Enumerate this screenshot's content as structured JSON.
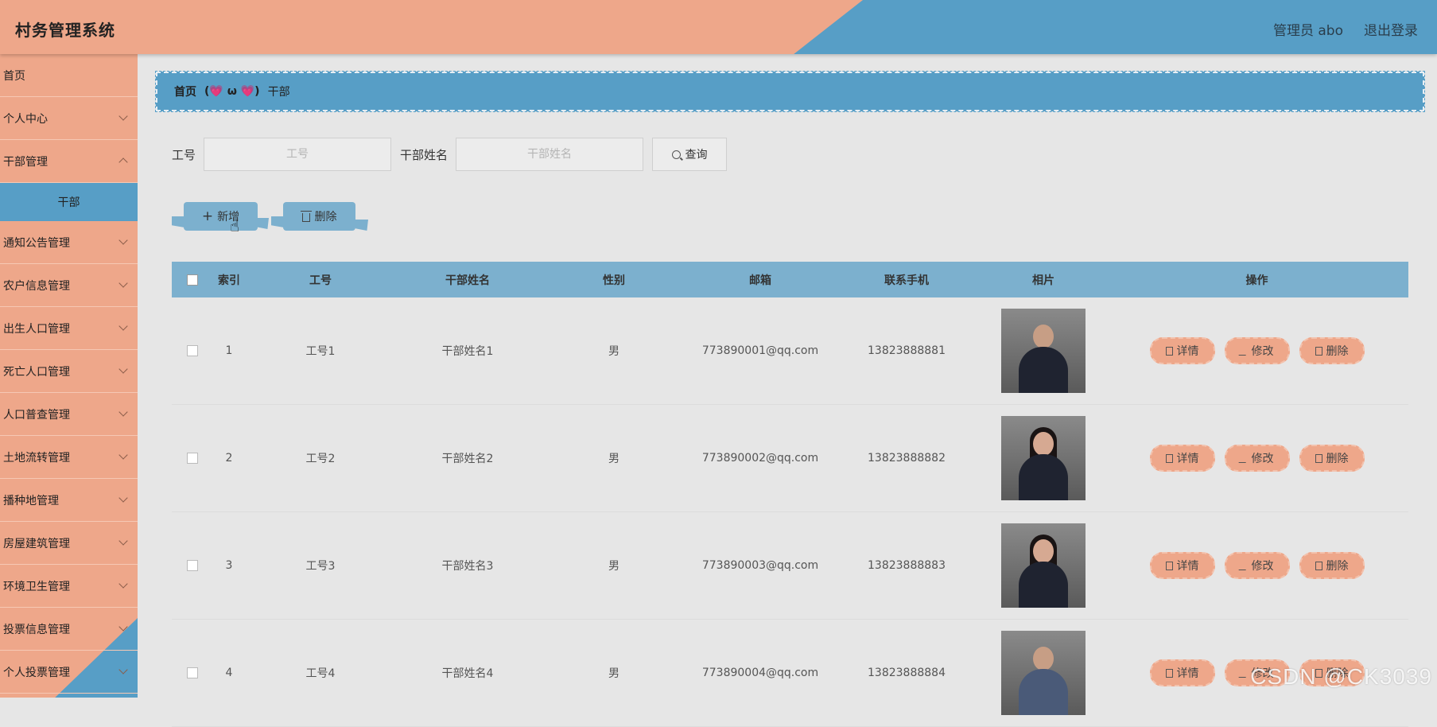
{
  "app": {
    "title": "村务管理系统",
    "user": "管理员 abo",
    "logout": "退出登录",
    "colors": {
      "peach": "#eea78a",
      "blue": "#579ec6",
      "table_header": "#7cb0ce"
    }
  },
  "sidebar": {
    "items": [
      {
        "label": "首页",
        "chevron": false
      },
      {
        "label": "个人中心",
        "chevron": true
      },
      {
        "label": "干部管理",
        "chevron": true
      },
      {
        "label": "通知公告管理",
        "chevron": true
      },
      {
        "label": "农户信息管理",
        "chevron": true
      },
      {
        "label": "出生人口管理",
        "chevron": true
      },
      {
        "label": "死亡人口管理",
        "chevron": true
      },
      {
        "label": "人口普查管理",
        "chevron": true
      },
      {
        "label": "土地流转管理",
        "chevron": true
      },
      {
        "label": "播种地管理",
        "chevron": true
      },
      {
        "label": "房屋建筑管理",
        "chevron": true
      },
      {
        "label": "环境卫生管理",
        "chevron": true
      },
      {
        "label": "投票信息管理",
        "chevron": true
      },
      {
        "label": "个人投票管理",
        "chevron": true
      }
    ],
    "active_sub": "干部"
  },
  "breadcrumb": {
    "home": "首页",
    "separator": "(💗 ω 💗)",
    "current": "干部"
  },
  "search": {
    "no_label": "工号",
    "no_placeholder": "工号",
    "name_label": "干部姓名",
    "name_placeholder": "干部姓名",
    "query_label": "查询"
  },
  "actions": {
    "add_label": "新增",
    "delete_label": "删除"
  },
  "table": {
    "headers": [
      "索引",
      "工号",
      "干部姓名",
      "性别",
      "邮箱",
      "联系手机",
      "相片",
      "操作"
    ],
    "rows": [
      {
        "index": "1",
        "no": "工号1",
        "name": "干部姓名1",
        "sex": "男",
        "email": "773890001@qq.com",
        "phone": "13823888881"
      },
      {
        "index": "2",
        "no": "工号2",
        "name": "干部姓名2",
        "sex": "男",
        "email": "773890002@qq.com",
        "phone": "13823888882"
      },
      {
        "index": "3",
        "no": "工号3",
        "name": "干部姓名3",
        "sex": "男",
        "email": "773890003@qq.com",
        "phone": "13823888883"
      },
      {
        "index": "4",
        "no": "工号4",
        "name": "干部姓名4",
        "sex": "男",
        "email": "773890004@qq.com",
        "phone": "13823888884"
      }
    ],
    "ops": {
      "detail": "详情",
      "edit": "修改",
      "delete": "删除"
    }
  },
  "watermark": "CSDN @CK3039"
}
